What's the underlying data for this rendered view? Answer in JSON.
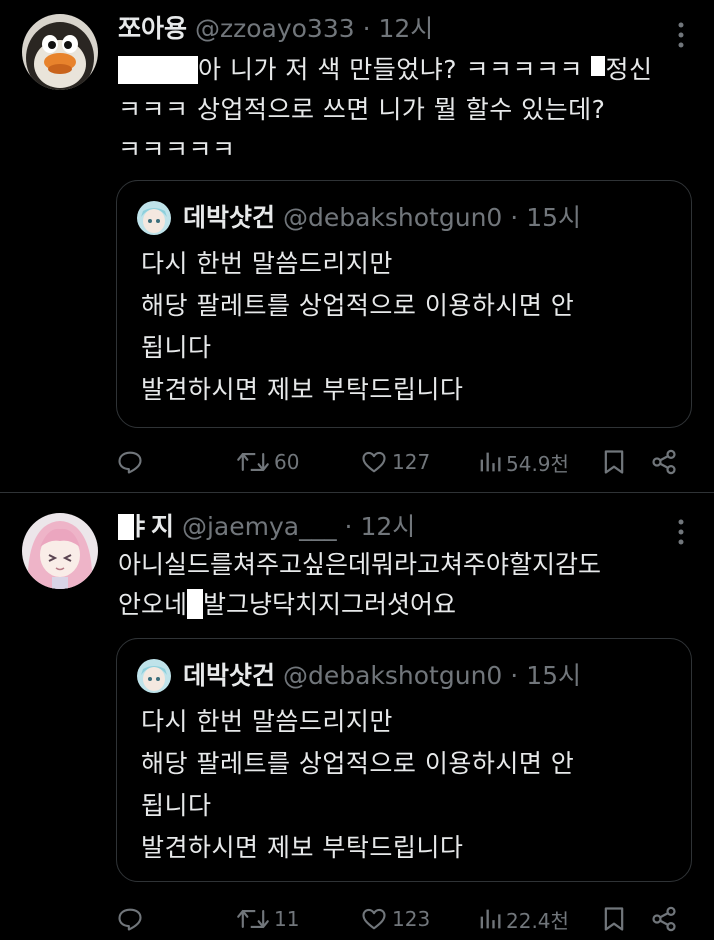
{
  "tweets": [
    {
      "name": "쪼아용",
      "handle": "@zzoayo333",
      "sep": "·",
      "time": "12시",
      "text_a": "아 니가 저 색 만들었냐? ㅋㅋㅋㅋㅋ ",
      "text_b": "정신",
      "text_c": "ㅋㅋㅋ 상업적으로 쓰면 니가 뭘 할수 있는데?",
      "text_d": "ㅋㅋㅋㅋㅋ",
      "quote": {
        "name": "데박샷건",
        "handle": "@debakshotgun0",
        "sep": "·",
        "time": "15시",
        "lines": [
          "다시 한번 말씀드리지만",
          "해당 팔레트를 상업적으로 이용하시면 안",
          "됩니다",
          "발견하시면 제보 부탁드립니다"
        ]
      },
      "retweets": "60",
      "likes": "127",
      "views": "54.9천"
    },
    {
      "name": "ㅑ지",
      "handle": "@jaemya___",
      "sep": "·",
      "time": "12시",
      "text_a": "아니실드를쳐주고싶은데뭐라고쳐주야할지감도",
      "text_b": "안오네",
      "text_c": "발그냥닥치지그러셧어요",
      "quote": {
        "name": "데박샷건",
        "handle": "@debakshotgun0",
        "sep": "·",
        "time": "15시",
        "lines": [
          "다시 한번 말씀드리지만",
          "해당 팔레트를 상업적으로 이용하시면 안",
          "됩니다",
          "발견하시면 제보 부탁드립니다"
        ]
      },
      "retweets": "11",
      "likes": "123",
      "views": "22.4천"
    }
  ],
  "icons": [
    "more-icon",
    "reply-icon",
    "retweet-icon",
    "like-icon",
    "views-icon",
    "bookmark-icon",
    "share-icon"
  ],
  "colors": {
    "background": "#000000",
    "text": "#e7e9ea",
    "secondary": "#71767b",
    "border": "#2f3336",
    "redaction": "#ffffff"
  }
}
